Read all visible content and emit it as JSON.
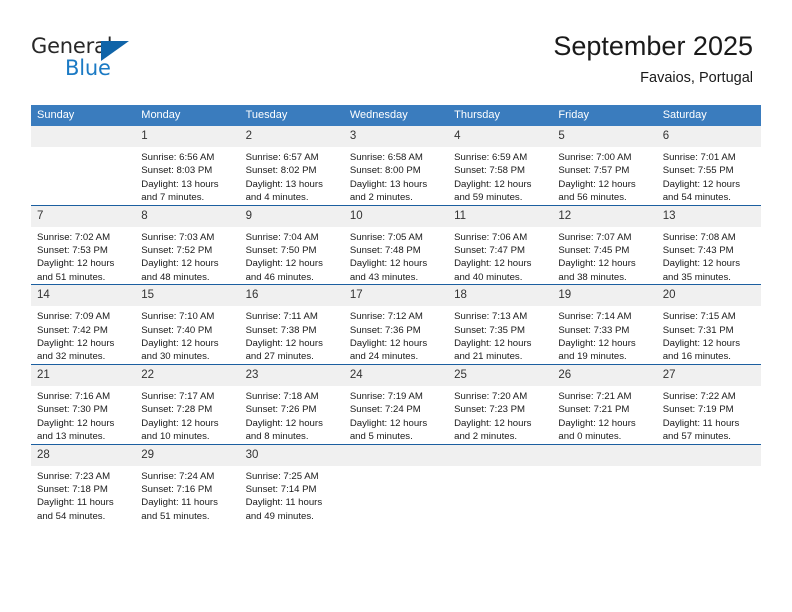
{
  "brand": {
    "name_part1": "General",
    "name_part2": "Blue",
    "triangle_color": "#1064a8",
    "blue_color": "#1b7ac4"
  },
  "header": {
    "title": "September 2025",
    "location": "Favaios, Portugal"
  },
  "theme": {
    "header_row_bg": "#3a7cbe",
    "header_row_text": "#ffffff",
    "daynum_bg": "#f0f0f0",
    "row_divider": "#1c5fa0",
    "cell_bg": "#ffffff"
  },
  "weekday_headers": [
    "Sunday",
    "Monday",
    "Tuesday",
    "Wednesday",
    "Thursday",
    "Friday",
    "Saturday"
  ],
  "weeks": [
    [
      {
        "day": "",
        "sunrise": "",
        "sunset": "",
        "daylight_line1": "",
        "daylight_line2": ""
      },
      {
        "day": "1",
        "sunrise": "Sunrise: 6:56 AM",
        "sunset": "Sunset: 8:03 PM",
        "daylight_line1": "Daylight: 13 hours",
        "daylight_line2": "and 7 minutes."
      },
      {
        "day": "2",
        "sunrise": "Sunrise: 6:57 AM",
        "sunset": "Sunset: 8:02 PM",
        "daylight_line1": "Daylight: 13 hours",
        "daylight_line2": "and 4 minutes."
      },
      {
        "day": "3",
        "sunrise": "Sunrise: 6:58 AM",
        "sunset": "Sunset: 8:00 PM",
        "daylight_line1": "Daylight: 13 hours",
        "daylight_line2": "and 2 minutes."
      },
      {
        "day": "4",
        "sunrise": "Sunrise: 6:59 AM",
        "sunset": "Sunset: 7:58 PM",
        "daylight_line1": "Daylight: 12 hours",
        "daylight_line2": "and 59 minutes."
      },
      {
        "day": "5",
        "sunrise": "Sunrise: 7:00 AM",
        "sunset": "Sunset: 7:57 PM",
        "daylight_line1": "Daylight: 12 hours",
        "daylight_line2": "and 56 minutes."
      },
      {
        "day": "6",
        "sunrise": "Sunrise: 7:01 AM",
        "sunset": "Sunset: 7:55 PM",
        "daylight_line1": "Daylight: 12 hours",
        "daylight_line2": "and 54 minutes."
      }
    ],
    [
      {
        "day": "7",
        "sunrise": "Sunrise: 7:02 AM",
        "sunset": "Sunset: 7:53 PM",
        "daylight_line1": "Daylight: 12 hours",
        "daylight_line2": "and 51 minutes."
      },
      {
        "day": "8",
        "sunrise": "Sunrise: 7:03 AM",
        "sunset": "Sunset: 7:52 PM",
        "daylight_line1": "Daylight: 12 hours",
        "daylight_line2": "and 48 minutes."
      },
      {
        "day": "9",
        "sunrise": "Sunrise: 7:04 AM",
        "sunset": "Sunset: 7:50 PM",
        "daylight_line1": "Daylight: 12 hours",
        "daylight_line2": "and 46 minutes."
      },
      {
        "day": "10",
        "sunrise": "Sunrise: 7:05 AM",
        "sunset": "Sunset: 7:48 PM",
        "daylight_line1": "Daylight: 12 hours",
        "daylight_line2": "and 43 minutes."
      },
      {
        "day": "11",
        "sunrise": "Sunrise: 7:06 AM",
        "sunset": "Sunset: 7:47 PM",
        "daylight_line1": "Daylight: 12 hours",
        "daylight_line2": "and 40 minutes."
      },
      {
        "day": "12",
        "sunrise": "Sunrise: 7:07 AM",
        "sunset": "Sunset: 7:45 PM",
        "daylight_line1": "Daylight: 12 hours",
        "daylight_line2": "and 38 minutes."
      },
      {
        "day": "13",
        "sunrise": "Sunrise: 7:08 AM",
        "sunset": "Sunset: 7:43 PM",
        "daylight_line1": "Daylight: 12 hours",
        "daylight_line2": "and 35 minutes."
      }
    ],
    [
      {
        "day": "14",
        "sunrise": "Sunrise: 7:09 AM",
        "sunset": "Sunset: 7:42 PM",
        "daylight_line1": "Daylight: 12 hours",
        "daylight_line2": "and 32 minutes."
      },
      {
        "day": "15",
        "sunrise": "Sunrise: 7:10 AM",
        "sunset": "Sunset: 7:40 PM",
        "daylight_line1": "Daylight: 12 hours",
        "daylight_line2": "and 30 minutes."
      },
      {
        "day": "16",
        "sunrise": "Sunrise: 7:11 AM",
        "sunset": "Sunset: 7:38 PM",
        "daylight_line1": "Daylight: 12 hours",
        "daylight_line2": "and 27 minutes."
      },
      {
        "day": "17",
        "sunrise": "Sunrise: 7:12 AM",
        "sunset": "Sunset: 7:36 PM",
        "daylight_line1": "Daylight: 12 hours",
        "daylight_line2": "and 24 minutes."
      },
      {
        "day": "18",
        "sunrise": "Sunrise: 7:13 AM",
        "sunset": "Sunset: 7:35 PM",
        "daylight_line1": "Daylight: 12 hours",
        "daylight_line2": "and 21 minutes."
      },
      {
        "day": "19",
        "sunrise": "Sunrise: 7:14 AM",
        "sunset": "Sunset: 7:33 PM",
        "daylight_line1": "Daylight: 12 hours",
        "daylight_line2": "and 19 minutes."
      },
      {
        "day": "20",
        "sunrise": "Sunrise: 7:15 AM",
        "sunset": "Sunset: 7:31 PM",
        "daylight_line1": "Daylight: 12 hours",
        "daylight_line2": "and 16 minutes."
      }
    ],
    [
      {
        "day": "21",
        "sunrise": "Sunrise: 7:16 AM",
        "sunset": "Sunset: 7:30 PM",
        "daylight_line1": "Daylight: 12 hours",
        "daylight_line2": "and 13 minutes."
      },
      {
        "day": "22",
        "sunrise": "Sunrise: 7:17 AM",
        "sunset": "Sunset: 7:28 PM",
        "daylight_line1": "Daylight: 12 hours",
        "daylight_line2": "and 10 minutes."
      },
      {
        "day": "23",
        "sunrise": "Sunrise: 7:18 AM",
        "sunset": "Sunset: 7:26 PM",
        "daylight_line1": "Daylight: 12 hours",
        "daylight_line2": "and 8 minutes."
      },
      {
        "day": "24",
        "sunrise": "Sunrise: 7:19 AM",
        "sunset": "Sunset: 7:24 PM",
        "daylight_line1": "Daylight: 12 hours",
        "daylight_line2": "and 5 minutes."
      },
      {
        "day": "25",
        "sunrise": "Sunrise: 7:20 AM",
        "sunset": "Sunset: 7:23 PM",
        "daylight_line1": "Daylight: 12 hours",
        "daylight_line2": "and 2 minutes."
      },
      {
        "day": "26",
        "sunrise": "Sunrise: 7:21 AM",
        "sunset": "Sunset: 7:21 PM",
        "daylight_line1": "Daylight: 12 hours",
        "daylight_line2": "and 0 minutes."
      },
      {
        "day": "27",
        "sunrise": "Sunrise: 7:22 AM",
        "sunset": "Sunset: 7:19 PM",
        "daylight_line1": "Daylight: 11 hours",
        "daylight_line2": "and 57 minutes."
      }
    ],
    [
      {
        "day": "28",
        "sunrise": "Sunrise: 7:23 AM",
        "sunset": "Sunset: 7:18 PM",
        "daylight_line1": "Daylight: 11 hours",
        "daylight_line2": "and 54 minutes."
      },
      {
        "day": "29",
        "sunrise": "Sunrise: 7:24 AM",
        "sunset": "Sunset: 7:16 PM",
        "daylight_line1": "Daylight: 11 hours",
        "daylight_line2": "and 51 minutes."
      },
      {
        "day": "30",
        "sunrise": "Sunrise: 7:25 AM",
        "sunset": "Sunset: 7:14 PM",
        "daylight_line1": "Daylight: 11 hours",
        "daylight_line2": "and 49 minutes."
      },
      {
        "day": "",
        "sunrise": "",
        "sunset": "",
        "daylight_line1": "",
        "daylight_line2": ""
      },
      {
        "day": "",
        "sunrise": "",
        "sunset": "",
        "daylight_line1": "",
        "daylight_line2": ""
      },
      {
        "day": "",
        "sunrise": "",
        "sunset": "",
        "daylight_line1": "",
        "daylight_line2": ""
      },
      {
        "day": "",
        "sunrise": "",
        "sunset": "",
        "daylight_line1": "",
        "daylight_line2": ""
      }
    ]
  ]
}
